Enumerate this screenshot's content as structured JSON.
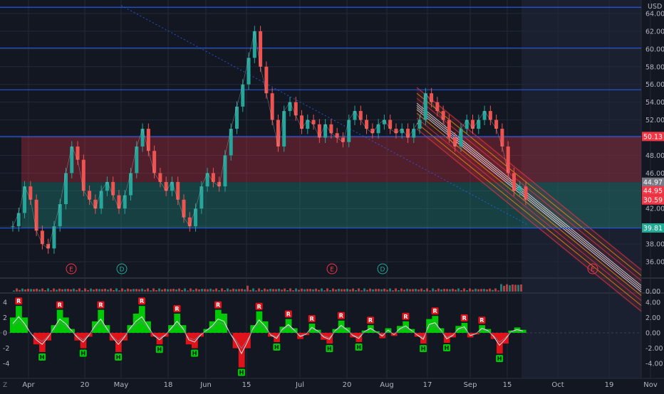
{
  "chart_data": {
    "type": "candlestick",
    "currency": "USD",
    "x_month_labels": [
      "Apr",
      "20",
      "May",
      "18",
      "Jun",
      "15",
      "Jul",
      "20",
      "Aug",
      "17",
      "Sep",
      "15",
      "Oct",
      "19",
      "Nov"
    ],
    "price_axis": {
      "ylim": [
        34.4,
        65.2
      ],
      "ticks": [
        "64.00",
        "62.00",
        "60.00",
        "58.00",
        "56.00",
        "54.00",
        "52.00",
        "50.00",
        "48.00",
        "46.00",
        "44.00",
        "42.00",
        "40.00",
        "38.00",
        "36.00"
      ]
    },
    "price_badges": [
      {
        "label": "50.13",
        "value": 50.13,
        "color": "#f23645"
      },
      {
        "label": "44.97",
        "value": 44.97,
        "color": "#787b86"
      },
      {
        "label": "44.95",
        "value": 44.95,
        "color": "#f23645"
      },
      {
        "label": "30.59",
        "value": 43.9,
        "color": "#f23645"
      },
      {
        "label": "39.81",
        "value": 39.81,
        "color": "#22ab94"
      }
    ],
    "horizontal_levels": [
      64.7,
      60.1,
      55.4,
      50.13,
      39.81
    ],
    "zones": [
      {
        "name": "resistance",
        "from": 44.97,
        "to": 50.13,
        "color": "#f23645"
      },
      {
        "name": "support",
        "from": 39.81,
        "to": 44.97,
        "color": "#22ab94"
      }
    ],
    "price_series_close": [
      40,
      41.5,
      44.5,
      43,
      39.5,
      38,
      37.5,
      40,
      42.5,
      46,
      49,
      47.5,
      44,
      43,
      42,
      44,
      45,
      43.5,
      42,
      43.5,
      46,
      49,
      51,
      48.5,
      46,
      45,
      44,
      45,
      43,
      41,
      40,
      42,
      44.5,
      46,
      45,
      44.5,
      48,
      51,
      53.5,
      56,
      59,
      62,
      58,
      55,
      52,
      49,
      53,
      54,
      52.5,
      51,
      52,
      51.5,
      50,
      51.5,
      50.5,
      50,
      49.5,
      52,
      53,
      52,
      51,
      50.5,
      51.5,
      52,
      51,
      50.5,
      51,
      50,
      51,
      52,
      55,
      54,
      53,
      52,
      50,
      49,
      51,
      52,
      51,
      52,
      53,
      52,
      51,
      49,
      46,
      44,
      44.5,
      43
    ],
    "events": [
      {
        "label": "E",
        "type": "earnings"
      },
      {
        "label": "D",
        "type": "dividend"
      },
      {
        "label": "E",
        "type": "earnings"
      },
      {
        "label": "D",
        "type": "dividend"
      },
      {
        "label": "E",
        "type": "earnings"
      }
    ],
    "volume_axis": {
      "label": "0.00"
    },
    "oscillator": {
      "ylim": [
        -5,
        5
      ],
      "left_ticks": [
        "4",
        "2",
        "0",
        "-2",
        "-4"
      ],
      "right_ticks": [
        "4.00",
        "2.00",
        "0.00",
        "-2.00",
        "-4.00"
      ],
      "values": [
        2,
        3.5,
        2,
        0,
        -1.5,
        -2.5,
        -1,
        1,
        3,
        2,
        0.5,
        -1,
        -2,
        -0.5,
        1.5,
        3,
        1,
        -1,
        -2.5,
        -1,
        1,
        2.5,
        3.5,
        1.5,
        -0.5,
        -1.5,
        -0.5,
        1,
        2.5,
        1,
        -1.5,
        -2,
        -0.5,
        0.5,
        1.5,
        3,
        2.5,
        0,
        -2,
        -4.5,
        -2,
        1,
        2.8,
        1.5,
        -0.5,
        -1.2,
        0.8,
        1.8,
        0.6,
        -0.8,
        -0.3,
        1.2,
        0.4,
        -0.9,
        -1.4,
        0.5,
        1.6,
        0.7,
        -0.6,
        -1.2,
        0.3,
        1.0,
        0.2,
        -0.7,
        0.6,
        -0.4,
        0.9,
        1.5,
        0.5,
        -0.5,
        -1.4,
        1.8,
        2.2,
        0.6,
        -1.3,
        -0.6,
        0.9,
        1.3,
        -0.6,
        -0.2,
        1.0,
        0.5,
        -0.8,
        -2.7,
        -1.4,
        0.3,
        0.7,
        0.4
      ],
      "markers": [
        {
          "label": "R",
          "kind": "peak"
        },
        {
          "label": "H",
          "kind": "trough"
        }
      ]
    }
  },
  "footer": {
    "corner_label": "Z"
  }
}
